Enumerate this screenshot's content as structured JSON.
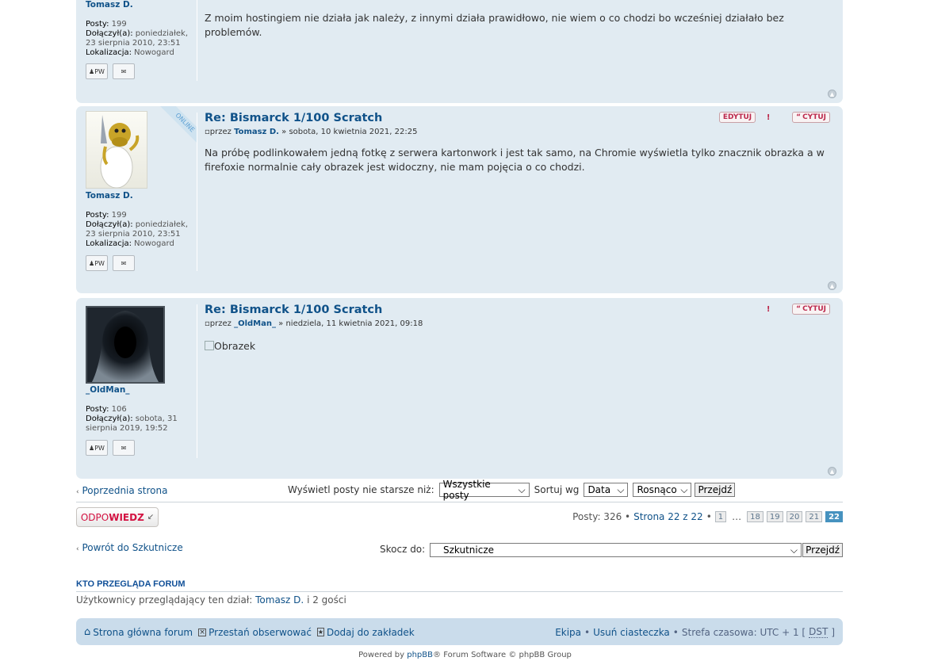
{
  "posts": [
    {
      "author": "Tomasz D.",
      "posts_label": "Posty:",
      "posts_count": "199",
      "joined_label": "Dołączył(a):",
      "joined_value_1": "poniedziałek,",
      "joined_value_2": "23 sierpnia 2010, 23:51",
      "location_label": "Lokalizacja:",
      "location_value": "Nowogard",
      "text": "Z moim hostingiem nie działa jak należy, z innymi działa prawidłowo, nie wiem o co chodzi bo wcześniej działało bez problemów."
    },
    {
      "title": "Re: Bismarck 1/100 Scratch",
      "meta_prefix": "przez",
      "author": "Tomasz D.",
      "date": "» sobota, 10 kwietnia 2021, 22:25",
      "online": "ONLINE",
      "posts_label": "Posty:",
      "posts_count": "199",
      "joined_label": "Dołączył(a):",
      "joined_value_1": "poniedziałek,",
      "joined_value_2": "23 sierpnia 2010, 23:51",
      "location_label": "Lokalizacja:",
      "location_value": "Nowogard",
      "edit_label": "EDYTUJ",
      "quote_label": "CYTUJ",
      "text": "Na próbę podlinkowałem jedną fotkę z serwera kartonwork i jest tak samo, na Chromie wyświetla tylko znacznik obrazka a w firefoxie normalnie cały obrazek jest widoczny, nie mam pojęcia o co chodzi."
    },
    {
      "title": "Re: Bismarck 1/100 Scratch",
      "meta_prefix": "przez",
      "author": "_OldMan_",
      "date": "» niedziela, 11 kwietnia 2021, 09:18",
      "posts_label": "Posty:",
      "posts_count": "106",
      "joined_label": "Dołączył(a):",
      "joined_value_1": "sobota, 31",
      "joined_value_2": "sierpnia 2019, 19:52",
      "quote_label": "CYTUJ",
      "image_alt": "Obrazek"
    }
  ],
  "pm_label": "PW",
  "prev_page": "Poprzednia strona",
  "filter": {
    "show_label": "Wyświetl posty nie starsze niż:",
    "show_value": "Wszystkie posty",
    "sort_label": "Sortuj wg",
    "sort_value": "Data",
    "order_value": "Rosnąco",
    "go": "Przejdź"
  },
  "reply": {
    "part1": "ODPO",
    "part2": "WIEDZ"
  },
  "pagination": {
    "summary": "Posty: 326 • ",
    "page_text": "Strona 22 z 22",
    "bullet": "•",
    "pages": [
      "1",
      "…",
      "18",
      "19",
      "20",
      "21",
      "22"
    ]
  },
  "back_link": "Powrót do Szkutnicze",
  "jump": {
    "label": "Skocz do:",
    "value": "Szkutnicze",
    "go": "Przejdź"
  },
  "who": {
    "heading": "KTO PRZEGLĄDA FORUM",
    "prefix": "Użytkownicy przeglądający ten dział:",
    "user": "Tomasz D.",
    "suffix": "i 2 gości"
  },
  "navbar": {
    "home": "Strona główna forum",
    "unwatch": "Przestań obserwować",
    "bookmark": "Dodaj do zakładek",
    "team": "Ekipa",
    "cookies": "Usuń ciasteczka",
    "tz": "Strefa czasowa: UTC + 1 [",
    "dst": "DST",
    "tz_end": "]"
  },
  "footer": {
    "prefix": "Powered by",
    "brand": "phpBB",
    "suffix": "® Forum Software © phpBB Group"
  }
}
